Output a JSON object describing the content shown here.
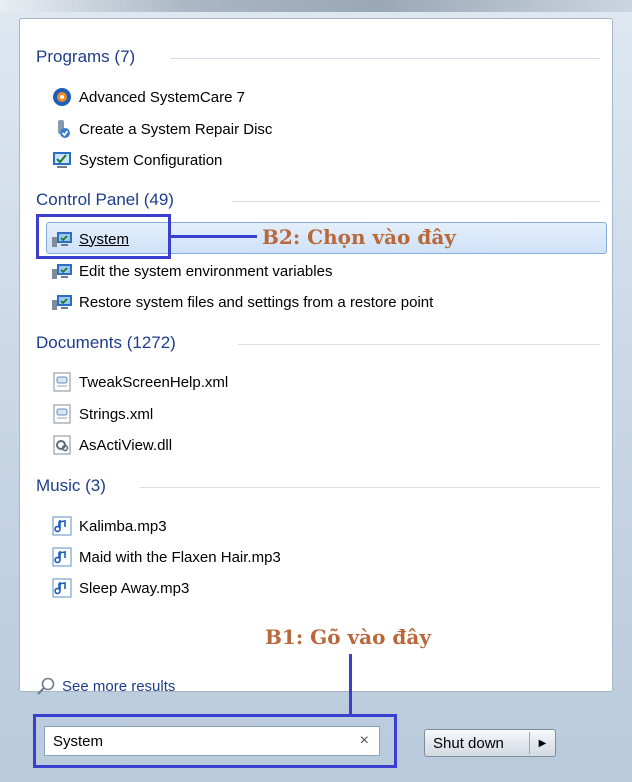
{
  "groups": {
    "programs": {
      "title": "Programs (7)",
      "items": [
        "Advanced SystemCare 7",
        "Create a System Repair Disc",
        "System Configuration"
      ]
    },
    "control_panel": {
      "title": "Control Panel (49)",
      "items": [
        "System",
        "Edit the system environment variables",
        "Restore system files and settings from a restore point"
      ]
    },
    "documents": {
      "title": "Documents (1272)",
      "items": [
        "TweakScreenHelp.xml",
        "Strings.xml",
        "AsActiView.dll"
      ]
    },
    "music": {
      "title": "Music (3)",
      "items": [
        "Kalimba.mp3",
        "Maid with the Flaxen Hair.mp3",
        "Sleep Away.mp3"
      ]
    }
  },
  "annotations": {
    "step2": "B2: Chọn vào đây",
    "step1": "B1: Gõ vào đây",
    "color": "#3b3fcf",
    "text_color": "#b8683a"
  },
  "see_more": "See more results",
  "search": {
    "value": "System",
    "clear": "×"
  },
  "shutdown": {
    "label": "Shut down",
    "arrow": "▶"
  },
  "colors": {
    "heading": "#1e3d8c",
    "selection": "#cfe2f8"
  }
}
